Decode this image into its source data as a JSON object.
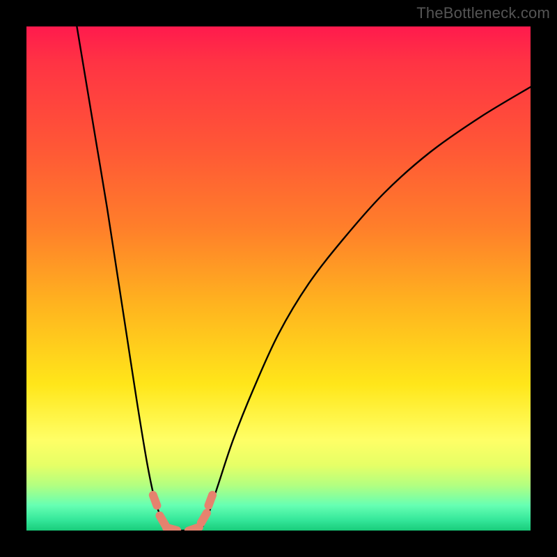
{
  "watermark": "TheBottleneck.com",
  "colors": {
    "frame": "#000000",
    "curve": "#000000",
    "marker_fill": "#e6826e",
    "marker_stroke": "#d06050"
  },
  "chart_data": {
    "type": "line",
    "title": "",
    "xlabel": "",
    "ylabel": "",
    "xlim": [
      0,
      100
    ],
    "ylim": [
      0,
      100
    ],
    "grid": false,
    "legend": false,
    "note": "Bottleneck-style V-shaped curve. y-axis inverted visually (0 at bottom = green/good, 100 at top = red/bad). Curve represents mismatch magnitude across some parameter x. Values estimated from pixel positions; no axis tick labels shown.",
    "series": [
      {
        "name": "left-branch",
        "x": [
          10,
          12,
          14,
          16,
          18,
          20,
          22,
          24,
          25.5,
          27,
          28.5
        ],
        "y": [
          100,
          88,
          76,
          64,
          51,
          38,
          25,
          13,
          6,
          2,
          0
        ]
      },
      {
        "name": "valley",
        "x": [
          28.5,
          30,
          31.5,
          33,
          34.5
        ],
        "y": [
          0,
          0,
          0,
          0,
          0
        ]
      },
      {
        "name": "right-branch",
        "x": [
          34.5,
          36,
          38,
          41,
          45,
          50,
          56,
          63,
          71,
          80,
          90,
          100
        ],
        "y": [
          0,
          3,
          9,
          18,
          28,
          39,
          49,
          58,
          67,
          75,
          82,
          88
        ]
      }
    ],
    "markers": {
      "name": "highlight-segments",
      "note": "Short thick pink capsule markers near the valley bottom",
      "points": [
        {
          "x": 25.5,
          "y": 6
        },
        {
          "x": 27.0,
          "y": 2
        },
        {
          "x": 28.8,
          "y": 0.3
        },
        {
          "x": 33.2,
          "y": 0.3
        },
        {
          "x": 35.2,
          "y": 2.5
        },
        {
          "x": 36.5,
          "y": 6
        }
      ]
    }
  }
}
